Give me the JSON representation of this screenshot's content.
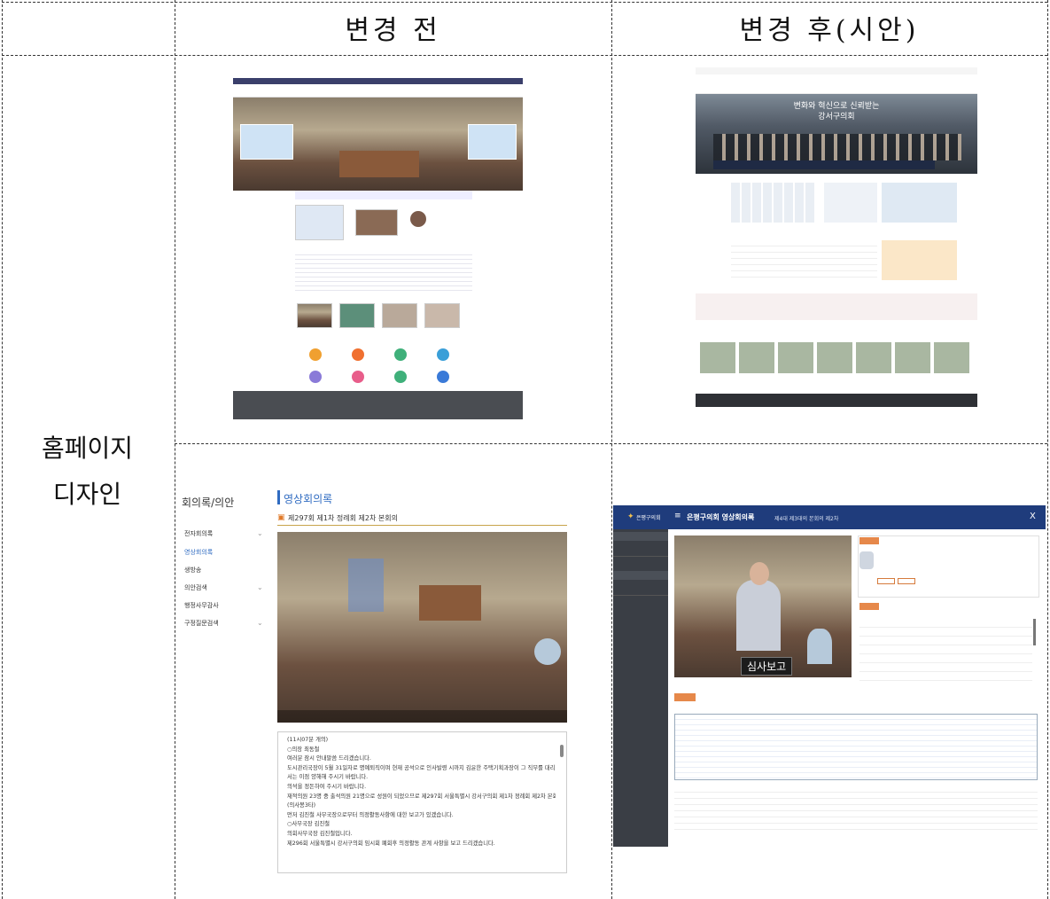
{
  "table": {
    "header_before": "변경 전",
    "header_after": "변경 후(시안)",
    "row_label_line1": "홈페이지",
    "row_label_line2": "디자인"
  },
  "before_video": {
    "sidebar_title": "회의록/의안",
    "sidebar_items": [
      "전자회의록",
      "영상회의록",
      "생방송",
      "의안검색",
      "행정사무감사",
      "구정질문검색"
    ],
    "page_title": "영상회의록",
    "session_title": "제297회 제1차 정례회 제2차 본회의",
    "transcript": [
      "(11시07분 개의)",
      "○의장 최동철",
      "여러분 잠시 안내말씀 드리겠습니다.",
      "도시관리국장이 5월 31일자로 명예퇴직이며 현재 공석으로 인사발령 시까지 김윤한 주택기획과장이 그 직무를 대리할 예정이오니 의원님들께",
      "서는 이점 양해해 주시기 바랍니다.",
      "의석을 정돈하여 주시기 바랍니다.",
      "재적의원 23명 중 출석의원 21명으로 성원이 되었으므로 제297회 서울특별시 강서구의회 제1차 정례회 제2차 본회의를 개의하겠습니다.",
      "(의사봉3타)",
      "먼저 김진철 사무국장으로부터 의정활동사항에 대한 보고가 있겠습니다.",
      "○사무국장 김진철",
      "의회사무국장 김진철입니다.",
      "제296회 서울특별시 강서구의회 임시회 폐회후 의정활동 관계 사항을 보고 드리겠습니다."
    ]
  },
  "after_video": {
    "window_title": "은평구의회 영상회의록",
    "subtitle": "제4대 제3대의 본회의 제2차",
    "close": "X",
    "caption": "심사보고",
    "logo_text": "은평구의회"
  },
  "after_home": {
    "hero_text_1": "변화와 혁신으로 신뢰받는",
    "hero_text_2": "강서구의회"
  }
}
